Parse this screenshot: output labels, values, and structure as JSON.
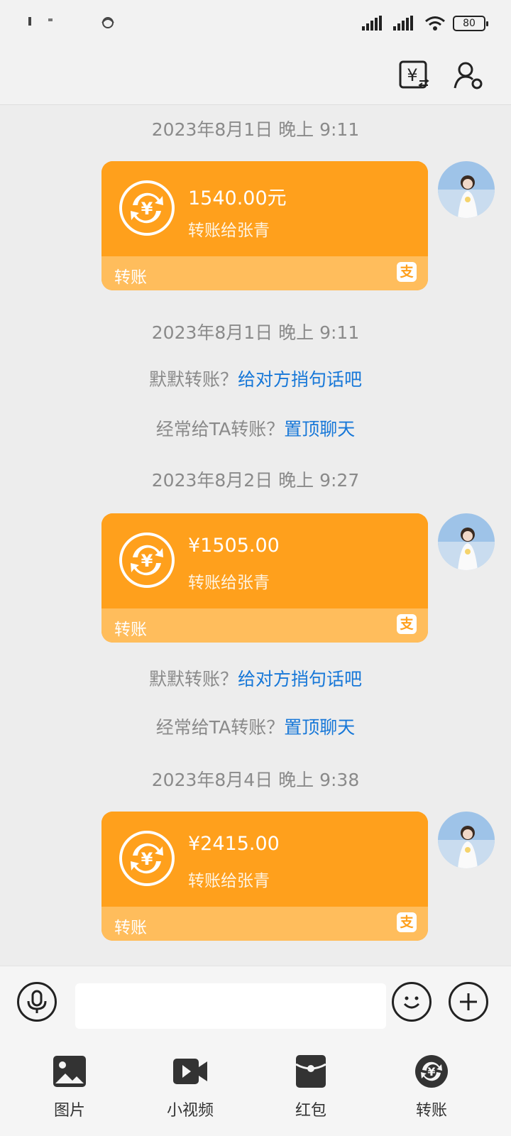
{
  "status_bar": {
    "battery": "80"
  },
  "header": {
    "transfer_icon": "yuan-transfer-icon",
    "profile_icon": "person-settings-icon"
  },
  "messages": {
    "ts0": "2023年8月1日 晚上 9:11",
    "card0": {
      "amount": "1540.00元",
      "desc": "转账给张青",
      "label": "转账",
      "logo": "支"
    },
    "ts1": "2023年8月1日 晚上 9:11",
    "tip_silent": {
      "text": "默默转账？",
      "link": "给对方捎句话吧"
    },
    "tip_pin": {
      "text": "经常给TA转账？",
      "link": "置顶聊天"
    },
    "ts2": "2023年8月2日 晚上 9:27",
    "card1": {
      "amount": "¥1505.00",
      "desc": "转账给张青",
      "label": "转账",
      "logo": "支"
    },
    "tip_silent2": {
      "text": "默默转账？",
      "link": "给对方捎句话吧"
    },
    "tip_pin2": {
      "text": "经常给TA转账？",
      "link": "置顶聊天"
    },
    "ts3": "2023年8月4日 晚上 9:38",
    "card2": {
      "amount": "¥2415.00",
      "desc": "转账给张青",
      "label": "转账",
      "logo": "支"
    }
  },
  "input_bar": {
    "voice_icon": "microphone-icon",
    "emoji_icon": "smiley-icon",
    "plus_icon": "plus-icon",
    "text_value": ""
  },
  "toolbar": {
    "items": [
      {
        "label": "图片",
        "icon": "image-icon"
      },
      {
        "label": "小视频",
        "icon": "video-icon"
      },
      {
        "label": "红包",
        "icon": "red-packet-icon"
      },
      {
        "label": "转账",
        "icon": "transfer-icon"
      }
    ]
  },
  "colors": {
    "card_top": "#ffa01c",
    "card_bottom": "#ffbd5c",
    "link": "#1677d8",
    "background": "#ededed"
  }
}
